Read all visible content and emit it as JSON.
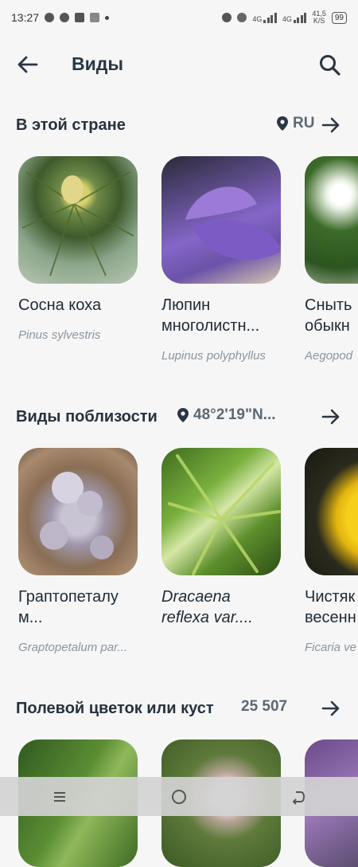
{
  "status_bar": {
    "time": "13:27",
    "net_speed_value": "41,5",
    "net_speed_unit": "K/S",
    "network_1": "4G",
    "network_2": "4G",
    "battery": "99"
  },
  "header": {
    "title": "Виды"
  },
  "section_country": {
    "title": "В этой стране",
    "region": "RU",
    "cards": [
      {
        "name": "Сосна коха",
        "latin": "Pinus sylvestris"
      },
      {
        "name": "Люпин многолистн...",
        "latin": "Lupinus polyphyllus"
      },
      {
        "name": "Сныть обыкн",
        "latin": "Aegopod"
      }
    ]
  },
  "section_nearby": {
    "title": "Виды поблизости",
    "location": "48°2'19\"N...",
    "cards": [
      {
        "name": "Граптопеталу м...",
        "latin": "Graptopetalum par..."
      },
      {
        "name": "Dracaena reflexa var....",
        "latin": ""
      },
      {
        "name": "Чистяк весенн",
        "latin": "Ficaria ve"
      }
    ]
  },
  "section_wildflower": {
    "title": "Полевой цветок или куст",
    "count": "25 507"
  },
  "colors": {
    "text_dark": "#27323f",
    "text_muted": "#8a95a0",
    "accent": "#2a3644",
    "background": "#f6f6f6"
  }
}
